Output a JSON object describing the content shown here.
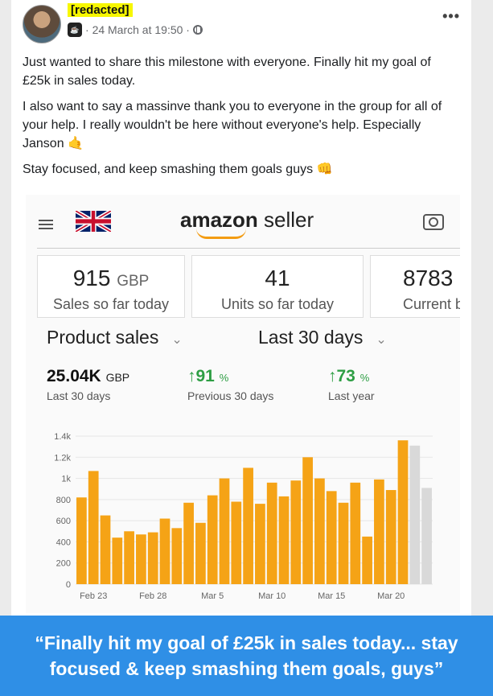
{
  "post": {
    "author": "[redacted]",
    "date": "24 March at 19:50",
    "badge": "☕",
    "more": "•••",
    "paragraphs": [
      "Just wanted to share this milestone with everyone. Finally hit my goal of £25k in sales today.",
      "I also want to say a massinve thank you to everyone in the group for all of your help. I really wouldn't be here without everyone's help. Especially Janson 🤙",
      "Stay focused, and keep smashing them goals guys 👊"
    ]
  },
  "amazon": {
    "logo_main": "amazon",
    "logo_sub": " seller",
    "cards": [
      {
        "value": "915",
        "unit": "GBP",
        "label": "Sales so far today"
      },
      {
        "value": "41",
        "unit": "",
        "label": "Units so far today"
      },
      {
        "value": "8783",
        "unit": "",
        "label": "Current b"
      }
    ],
    "dropdown_metric": "Product sales",
    "dropdown_period": "Last 30 days",
    "chevron": "⌄",
    "stats": [
      {
        "value": "25.04K",
        "unit": "GBP",
        "label": "Last 30 days"
      },
      {
        "value": "↑91",
        "unit": "%",
        "label": "Previous 30 days"
      },
      {
        "value": "↑73",
        "unit": "%",
        "label": "Last year"
      }
    ]
  },
  "chart_data": {
    "type": "bar",
    "categories": [
      "Feb 22",
      "Feb 23",
      "Feb 24",
      "Feb 25",
      "Feb 26",
      "Feb 27",
      "Feb 28",
      "Mar 1",
      "Mar 2",
      "Mar 3",
      "Mar 4",
      "Mar 5",
      "Mar 6",
      "Mar 7",
      "Mar 8",
      "Mar 9",
      "Mar 10",
      "Mar 11",
      "Mar 12",
      "Mar 13",
      "Mar 14",
      "Mar 15",
      "Mar 16",
      "Mar 17",
      "Mar 18",
      "Mar 19",
      "Mar 20",
      "Mar 21",
      "Mar 22",
      "Mar 23",
      "Mar 24"
    ],
    "x_tick_labels": [
      "Feb 23",
      "Feb 28",
      "Mar 5",
      "Mar 10",
      "Mar 15",
      "Mar 20"
    ],
    "series": [
      {
        "values": [
          820,
          1070,
          650,
          440,
          500,
          470,
          490,
          620,
          530,
          770,
          580,
          840,
          1000,
          780,
          1100,
          760,
          960,
          830,
          980,
          1200,
          1000,
          880,
          770,
          960,
          450,
          990,
          890,
          1360,
          1310,
          910
        ]
      }
    ],
    "ytick_labels": [
      "0",
      "200",
      "400",
      "600",
      "800",
      "1k",
      "1.2k",
      "1.4k"
    ],
    "ylim": [
      0,
      1400
    ],
    "colors": {
      "bar": "#f5a316",
      "projected": "#d9d9d9",
      "grid": "#e6e6e6"
    }
  },
  "caption": "“Finally hit my goal of £25k in sales today... stay focused & keep smashing them goals, guys”"
}
